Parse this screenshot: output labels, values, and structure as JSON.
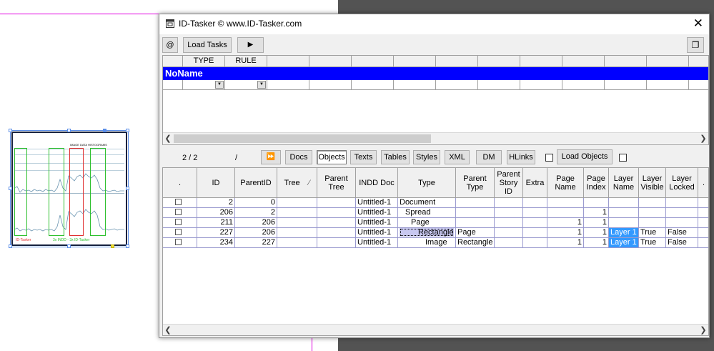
{
  "window": {
    "title": "ID-Tasker  © www.ID-Tasker.com",
    "close_glyph": "✕"
  },
  "toolbar1": {
    "at_label": "@",
    "load_tasks_label": "Load Tasks",
    "play_glyph": "▶",
    "restore_glyph": "❐"
  },
  "task_grid": {
    "headers": [
      "TYPE",
      "RULE"
    ],
    "noname_label": "NoName"
  },
  "toolbar2": {
    "counter": "2 / 2",
    "slash": "/",
    "ff_glyph": "⏩",
    "buttons": [
      "Docs",
      "Objects",
      "Texts",
      "Tables",
      "Styles",
      "XML",
      "DM",
      "HLinks"
    ],
    "active_button": "Objects",
    "load_objects_label": "Load Objects"
  },
  "objects_table": {
    "columns": [
      ".",
      "ID",
      "ParentID",
      "Tree",
      "Parent Tree",
      "INDD Doc",
      "Type",
      "Parent Type",
      "Parent Story ID",
      "Extra",
      "Page Name",
      "Page Index",
      "Layer Name",
      "Layer Visible",
      "Layer Locked",
      "."
    ],
    "tree_sort_glyph": "⁄",
    "rows": [
      {
        "id": "2",
        "parent_id": "0",
        "indd_doc": "Untitled-1",
        "type": "Document",
        "parent_type": "",
        "page_name": "",
        "page_index": "",
        "layer_name": "",
        "layer_visible": "",
        "layer_locked": ""
      },
      {
        "id": "206",
        "parent_id": "2",
        "indd_doc": "Untitled-1",
        "type": "Spread",
        "parent_type": "",
        "page_name": "",
        "page_index": "1",
        "layer_name": "",
        "layer_visible": "",
        "layer_locked": ""
      },
      {
        "id": "211",
        "parent_id": "206",
        "indd_doc": "Untitled-1",
        "type": "Page",
        "parent_type": "",
        "page_name": "1",
        "page_index": "1",
        "layer_name": "",
        "layer_visible": "",
        "layer_locked": ""
      },
      {
        "id": "227",
        "parent_id": "206",
        "indd_doc": "Untitled-1",
        "type": "Rectangle",
        "parent_type": "Page",
        "page_name": "1",
        "page_index": "1",
        "layer_name": "Layer 1",
        "layer_visible": "True",
        "layer_locked": "False"
      },
      {
        "id": "234",
        "parent_id": "227",
        "indd_doc": "Untitled-1",
        "type": "Image",
        "parent_type": "Rectangle",
        "page_name": "1",
        "page_index": "1",
        "layer_name": "Layer 1",
        "layer_visible": "True",
        "layer_locked": "False"
      }
    ]
  },
  "thumbnail": {
    "header_text": "IMAGE DATA HISTOGRAMS",
    "footer_left": "ID-Tasker",
    "footer_mid": "3x INDD - 3x ID-Tasker"
  },
  "colors": {
    "accent_blue": "#0000ff",
    "layer_highlight": "#3399ff",
    "dark_workspace": "#535353",
    "guide_pink": "#e000e0"
  }
}
